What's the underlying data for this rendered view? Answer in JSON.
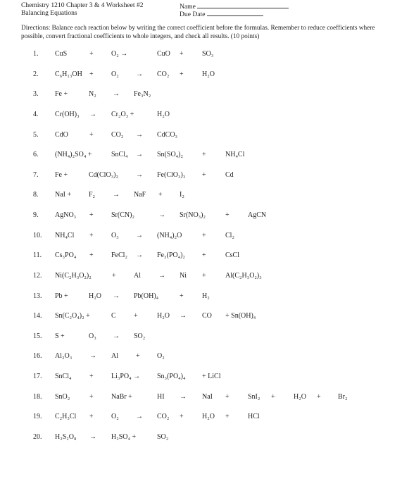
{
  "header": {
    "course_title": "Chemistry 1210  Chapter 3 & 4 Worksheet #2",
    "subtitle": "Balancing Equations",
    "name_label": "Name",
    "due_date_label": "Due Date"
  },
  "directions": "Directions:  Balance each reaction below by writing the correct coefficient before the formulas. Remember to reduce coefficients where possible, convert fractional coefficients to whole integers, and check all results. (10 points)",
  "equations": [
    {
      "number": "1.",
      "tokens": [
        "CuS",
        "+",
        "O₂ →",
        "CuO",
        "+",
        "SO₃"
      ]
    },
    {
      "number": "2.",
      "tokens": [
        "C₆H₁₃OH",
        "+",
        "O₂",
        "→",
        "CO₂",
        "+",
        "H₂O"
      ]
    },
    {
      "number": "3.",
      "tokens": [
        "Fe +",
        "N₂",
        "→",
        "Fe₃N₂"
      ]
    },
    {
      "number": "4.",
      "tokens": [
        "Cr(OH)₃",
        "→",
        "Cr₂O₃ +",
        "H₂O"
      ]
    },
    {
      "number": "5.",
      "tokens": [
        "CdO",
        "+",
        "CO₂",
        "→",
        "CdCO₃"
      ]
    },
    {
      "number": "6.",
      "tokens": [
        "(NH₄)₂SO₄ +",
        "SnCl₄",
        "→",
        "Sn(SO₄)₂",
        "+",
        "NH₄Cl"
      ]
    },
    {
      "number": "7.",
      "tokens": [
        "Fe +",
        "Cd(ClO₃)₂",
        "→",
        "Fe(ClO₃)₃",
        "+",
        "Cd"
      ]
    },
    {
      "number": "8.",
      "tokens": [
        "NaI +",
        "F₂",
        "→",
        "NaF",
        "+",
        "I₂"
      ]
    },
    {
      "number": "9.",
      "tokens": [
        "AgNO₃",
        "+",
        "Sr(CN)₂",
        "→",
        "Sr(NO₃)₂",
        "+",
        "AgCN"
      ]
    },
    {
      "number": "10.",
      "tokens": [
        "NH₄Cl",
        "+",
        "O₃",
        "→",
        "(NH₄)₂O",
        "+",
        "Cl₂"
      ]
    },
    {
      "number": "11.",
      "tokens": [
        "Cs₃PO₄",
        "+",
        "FeCl₂",
        "→",
        "Fe₃(PO₄)₂",
        "+",
        "CsCl"
      ]
    },
    {
      "number": "12.",
      "tokens": [
        "Ni(C₂H₃O₂)₂",
        "+",
        "Al",
        "→",
        "Ni",
        "+",
        "Al(C₂H₃O₂)₃"
      ]
    },
    {
      "number": "13.",
      "tokens": [
        "Pb +",
        "H₂O",
        "→",
        "Pb(OH)₄",
        "+",
        "H₂"
      ]
    },
    {
      "number": "14.",
      "tokens": [
        "Sn(C₂O₄)₂ +",
        "C",
        "+",
        "H₂O",
        "→",
        "CO",
        "+ Sn(OH)₄"
      ]
    },
    {
      "number": "15.",
      "tokens": [
        "S +",
        "O₃",
        "→",
        "SO₂"
      ]
    },
    {
      "number": "16.",
      "tokens": [
        "Al₂O₃",
        "→",
        "Al",
        "+",
        "O₂"
      ]
    },
    {
      "number": "17.",
      "tokens": [
        "SnCl₄",
        "+",
        "Li₃PO₄ →",
        "Sn₃(PO₄)₄",
        "+ LiCl"
      ]
    },
    {
      "number": "18.",
      "tokens": [
        "SnO₂",
        "+",
        "NaBr +",
        "HI",
        "→",
        "NaI",
        "+",
        "SnI₂",
        "+",
        "H₂O",
        "+",
        "Br₂"
      ]
    },
    {
      "number": "19.",
      "tokens": [
        "C₂H₃Cl",
        "+",
        "O₂",
        "→",
        "CO₂",
        "+",
        "H₂O",
        "+",
        "HCl"
      ]
    },
    {
      "number": "20.",
      "tokens": [
        "H₂S₂O₈",
        "→",
        "H₂SO₄ +",
        "SO₂"
      ]
    }
  ]
}
